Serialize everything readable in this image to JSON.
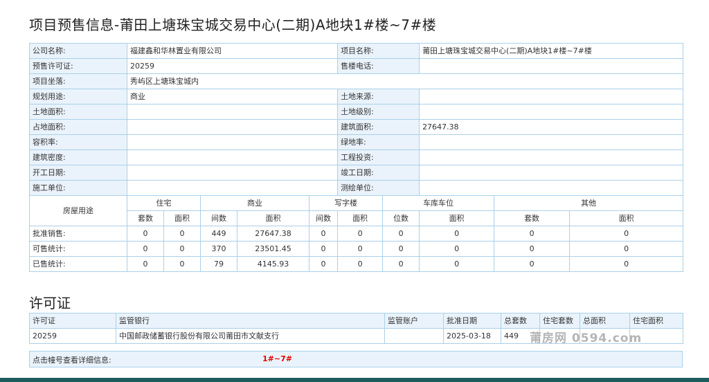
{
  "page": {
    "title": "项目预售信息-莆田上塘珠宝城交易中心(二期)A地块1#楼~7#楼"
  },
  "info": {
    "company_label": "公司名称:",
    "company_value": "福建鑫和华林置业有限公司",
    "project_label": "项目名称:",
    "project_value": "莆田上塘珠宝城交易中心(二期)A地块1#楼~7#楼",
    "presale_label": "预售许可证:",
    "presale_value": "20259",
    "phone_label": "售楼电话:",
    "phone_value": "",
    "location_label": "项目坐落:",
    "location_value": "秀屿区上塘珠宝城内",
    "planning_label": "规划用途:",
    "planning_value": "商业",
    "land_source_label": "土地来源:",
    "land_source_value": "",
    "land_area_label": "土地面积:",
    "land_area_value": "",
    "land_level_label": "土地级别:",
    "land_level_value": "",
    "occupy_label": "占地面积:",
    "occupy_value": "",
    "build_area_label": "建筑面积:",
    "build_area_value": "27647.38",
    "far_label": "容积率:",
    "far_value": "",
    "green_label": "绿地率:",
    "green_value": "",
    "density_label": "建筑密度:",
    "density_value": "",
    "invest_label": "工程投资:",
    "invest_value": "",
    "start_label": "开工日期:",
    "start_value": "",
    "finish_label": "竣工日期:",
    "finish_value": "",
    "builder_label": "施工单位:",
    "builder_value": "",
    "survey_label": "测绘单位:",
    "survey_value": ""
  },
  "usage": {
    "header": "房屋用途",
    "groups": [
      "住宅",
      "商业",
      "写字楼",
      "车库车位",
      "其他"
    ],
    "subheaders": [
      "套数",
      "面积",
      "间数",
      "面积",
      "间数",
      "面积",
      "位数",
      "面积",
      "套数",
      "面积"
    ],
    "rows": [
      {
        "label": "批准销售:",
        "values": [
          "0",
          "0",
          "449",
          "27647.38",
          "0",
          "0",
          "0",
          "0",
          "0",
          "0"
        ]
      },
      {
        "label": "可售统计:",
        "values": [
          "0",
          "0",
          "370",
          "23501.45",
          "0",
          "0",
          "0",
          "0",
          "0",
          "0"
        ]
      },
      {
        "label": "已售统计:",
        "values": [
          "0",
          "0",
          "79",
          "4145.93",
          "0",
          "0",
          "0",
          "0",
          "0",
          "0"
        ]
      }
    ]
  },
  "permit": {
    "section_title": "许可证",
    "headers": [
      "许可证",
      "监管银行",
      "监管账户",
      "批准日期",
      "总套数",
      "住宅套数",
      "总面积",
      "住宅面积"
    ],
    "rows": [
      [
        "20259",
        "中国邮政储蓄银行股份有限公司莆田市文献支行",
        "",
        "2025-03-18",
        "449",
        "",
        "",
        ""
      ]
    ]
  },
  "detail": {
    "label": "点击幢号查看详细信息:",
    "link": "1#~7#"
  },
  "watermark": "莆房网 0594.com"
}
